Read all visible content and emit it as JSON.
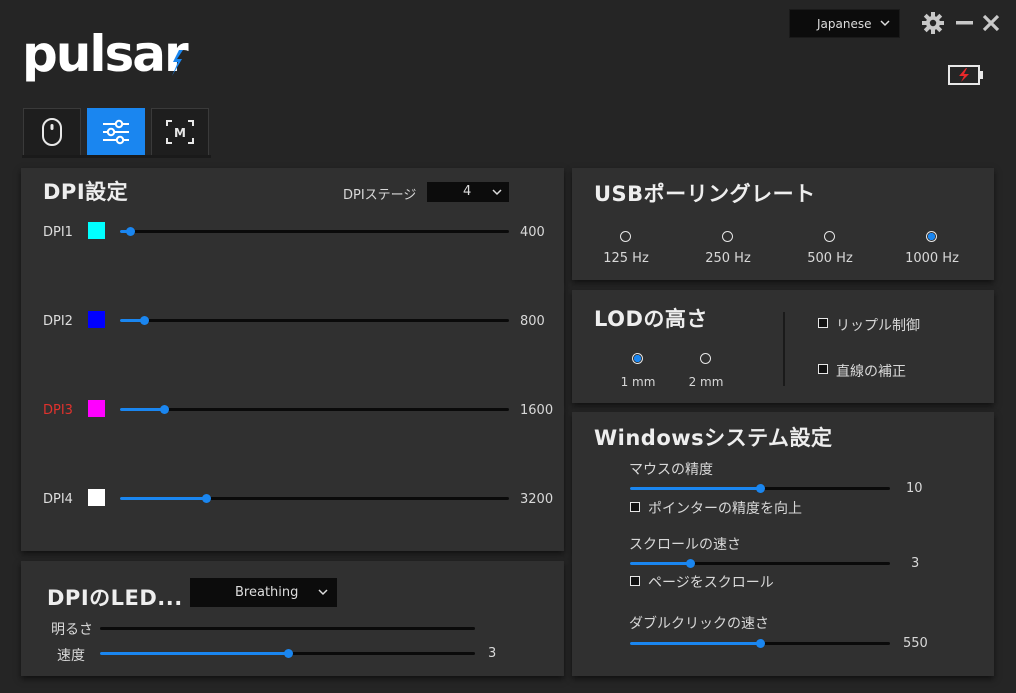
{
  "header": {
    "logo": "pulsar",
    "language": "Japanese"
  },
  "dpi": {
    "title": "DPI設定",
    "stage_label": "DPIステージ",
    "stage_value": "4",
    "rows": [
      {
        "label": "DPI1",
        "value": "400",
        "color": "#00ffff",
        "fraction": 0.025,
        "label_color": "#dddddd"
      },
      {
        "label": "DPI2",
        "value": "800",
        "color": "#0000ff",
        "fraction": 0.062,
        "label_color": "#dddddd"
      },
      {
        "label": "DPI3",
        "value": "1600",
        "color": "#ff00ff",
        "fraction": 0.114,
        "label_color": "#e0322d"
      },
      {
        "label": "DPI4",
        "value": "3200",
        "color": "#ffffff",
        "fraction": 0.222,
        "label_color": "#dddddd"
      }
    ]
  },
  "led": {
    "title": "DPIのLED...",
    "mode": "Breathing",
    "brightness_label": "明るさ",
    "brightness_fraction": 0,
    "speed_label": "速度",
    "speed_value": "3",
    "speed_fraction": 0.5
  },
  "usb": {
    "title": "USBポーリングレート",
    "options": [
      "125 Hz",
      "250 Hz",
      "500 Hz",
      "1000 Hz"
    ],
    "selected": 3
  },
  "lod": {
    "title": "LODの高さ",
    "options": [
      "1 mm",
      "2 mm"
    ],
    "selected": 0,
    "ripple_label": "リップル制御",
    "angle_label": "直線の補正"
  },
  "windows": {
    "title": "Windowsシステム設定",
    "mouse_speed_label": "マウスの精度",
    "mouse_speed_value": "10",
    "mouse_speed_fraction": 0.5,
    "pointer_precision_label": "ポインターの精度を向上",
    "scroll_label": "スクロールの速さ",
    "scroll_value": "3",
    "scroll_fraction": 0.23,
    "page_scroll_label": "ページをスクロール",
    "double_click_label": "ダブルクリックの速さ",
    "double_click_value": "550",
    "double_click_fraction": 0.5
  },
  "colors": {
    "accent": "#1a86f0",
    "battery_bolt": "#e8282a"
  }
}
